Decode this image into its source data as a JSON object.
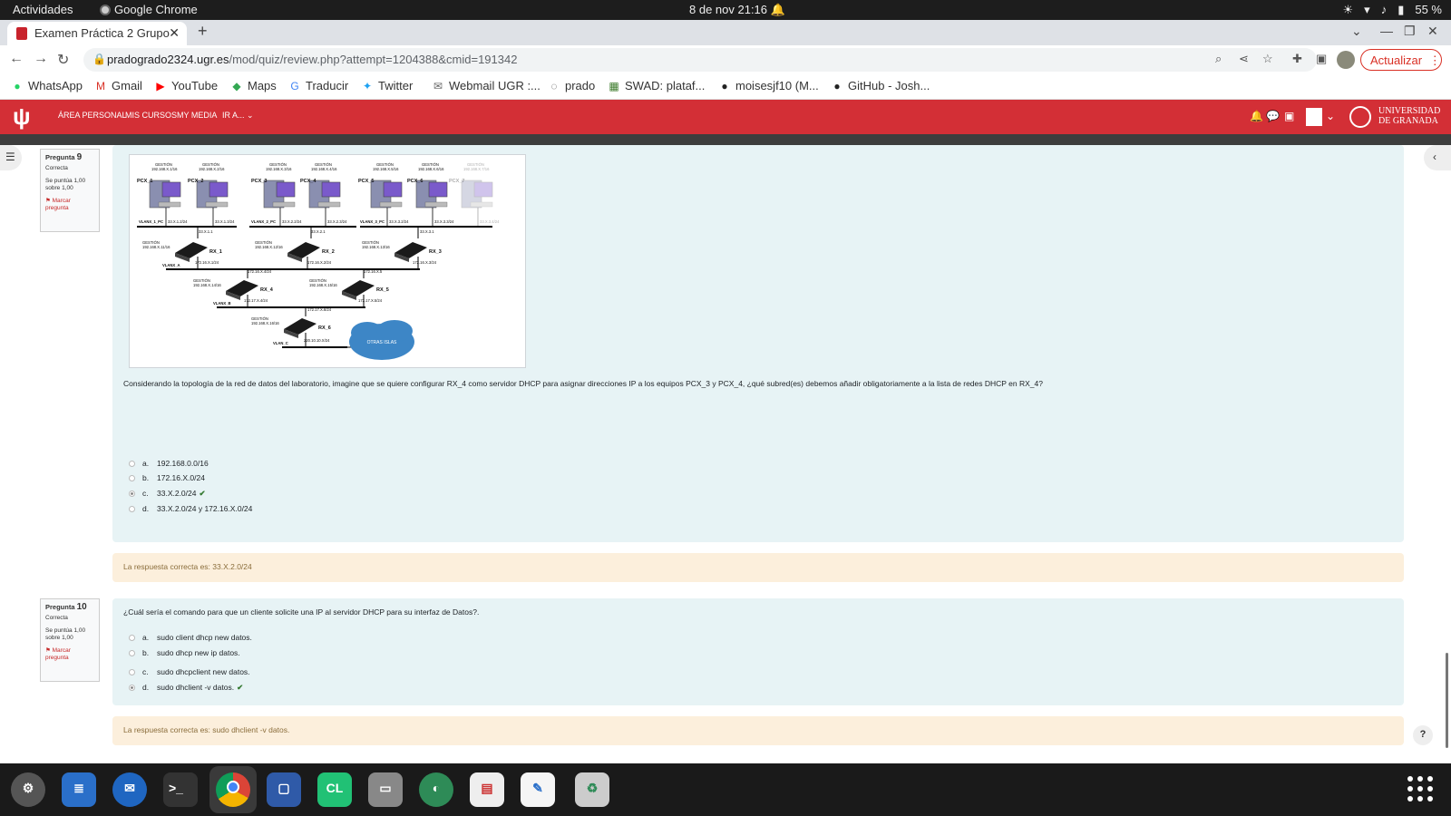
{
  "system": {
    "activities": "Actividades",
    "app_name": "Google Chrome",
    "clock": "8 de nov  21:16",
    "battery": "55 %"
  },
  "browser": {
    "tab_title": "Examen Práctica 2 Grupo",
    "url_host": "pradogrado2324.ugr.es",
    "url_path": "/mod/quiz/review.php?attempt=1204388&cmid=191342",
    "update_label": "Actualizar",
    "bookmarks": [
      "WhatsApp",
      "Gmail",
      "YouTube",
      "Maps",
      "Traducir",
      "Twitter",
      "Webmail UGR :...",
      "prado",
      "SWAD: plataf...",
      "moisesjf10 (M...",
      "GitHub - Josh..."
    ]
  },
  "moodle": {
    "menu": [
      "ÁREA PERSONAL",
      "MIS CURSOS",
      "MY MEDIA",
      "IR A..."
    ],
    "university_line1": "UNIVERSIDAD",
    "university_line2": "DE GRANADA"
  },
  "q9": {
    "label": "Pregunta",
    "number": "9",
    "state": "Correcta",
    "grade": "Se puntúa 1,00 sobre 1,00",
    "flag": "Marcar pregunta",
    "text": "Considerando la topología de la red de datos del laboratorio, imagine que se quiere configurar RX_4 como servidor DHCP para asignar direcciones IP a los equipos PCX_3 y PCX_4, ¿qué subred(es) debemos añadir obligatoriamente a la lista de redes DHCP en RX_4?",
    "options": [
      {
        "letter": "a.",
        "text": "192.168.0.0/16"
      },
      {
        "letter": "b.",
        "text": "172.16.X.0/24"
      },
      {
        "letter": "c.",
        "text": "33.X.2.0/24"
      },
      {
        "letter": "d.",
        "text": "33.X.2.0/24 y 172.16.X.0/24"
      }
    ],
    "feedback": "La respuesta correcta es: 33.X.2.0/24",
    "diagram": {
      "pcs": [
        "PCX_1",
        "PCX_2",
        "PCX_3",
        "PCX_4",
        "PCX_5",
        "PCX_6",
        "PCX_7"
      ],
      "gestion": "GESTIÓN",
      "pc_ips": [
        "192.168.X.1/16",
        "192.168.X.2/16",
        "192.168.X.3/16",
        "192.168.X.4/16",
        "192.168.X.5/16",
        "192.168.X.6/16",
        "192.168.X.7/16"
      ],
      "vlans": [
        "VLANX_1_PC",
        "VLANX_2_PC",
        "VLANX_3_PC"
      ],
      "pc_net_ips": [
        "33.X.1.2/24",
        "33.X.1.3/24",
        "33.X.2.2/24",
        "33.X.2.3/24",
        "33.X.3.2/24",
        "33.X.3.3/24",
        "33.X.3.4/24"
      ],
      "gw_ips": [
        "33.X.1.1",
        "33.X.2.1",
        "33.X.3.1"
      ],
      "routers": [
        "RX_1",
        "RX_2",
        "RX_3",
        "RX_4",
        "RX_5",
        "RX_6"
      ],
      "router_mgmt": [
        "192.168.X.11/16",
        "192.168.X.12/16",
        "192.168.X.13/16",
        "192.168.X.14/16",
        "192.168.X.15/16",
        "192.168.X.16/16"
      ],
      "vlan_a": "VLANX_A",
      "vlan_b": "VLANX_B",
      "vlan_c": "VLAN_C",
      "net_a_ips": [
        "172.16.X.1/24",
        "172.16.X.2/24",
        "172.16.X.3/24",
        "172.16.X.4/24",
        "172.16.X.5"
      ],
      "net_b_ips": [
        "172.17.X.4/24",
        "172.17.X.5/24",
        "172.17.X.6/24"
      ],
      "net_c_ip": "220.10.10.X/24",
      "cloud": "OTRAS ISLAS"
    }
  },
  "q10": {
    "label": "Pregunta",
    "number": "10",
    "state": "Correcta",
    "grade": "Se puntúa 1,00 sobre 1,00",
    "flag": "Marcar pregunta",
    "text": "¿Cuál sería el comando para que un cliente solicite una IP al servidor DHCP para su interfaz de Datos?.",
    "options": [
      {
        "letter": "a.",
        "text": "sudo client dhcp new datos."
      },
      {
        "letter": "b.",
        "text": "sudo dhcp new ip datos."
      },
      {
        "letter": "c.",
        "text": "sudo dhcpclient new datos."
      },
      {
        "letter": "d.",
        "text": "sudo dhclient -v datos."
      }
    ],
    "feedback": "La respuesta correcta es: sudo dhclient -v datos."
  },
  "help_label": "?",
  "colors": {
    "moodle_red": "#d32f36",
    "question_bg": "#e7f3f5",
    "feedback_bg": "#fcefdc",
    "correct_green": "#357a32"
  },
  "dock_icons": [
    "settings-icon",
    "writer-icon",
    "thunderbird-icon",
    "terminal-icon",
    "chrome-icon",
    "virtualbox-icon",
    "clion-icon",
    "files-icon",
    "network-icon",
    "document-viewer-icon",
    "text-editor-icon",
    "trash-icon"
  ]
}
